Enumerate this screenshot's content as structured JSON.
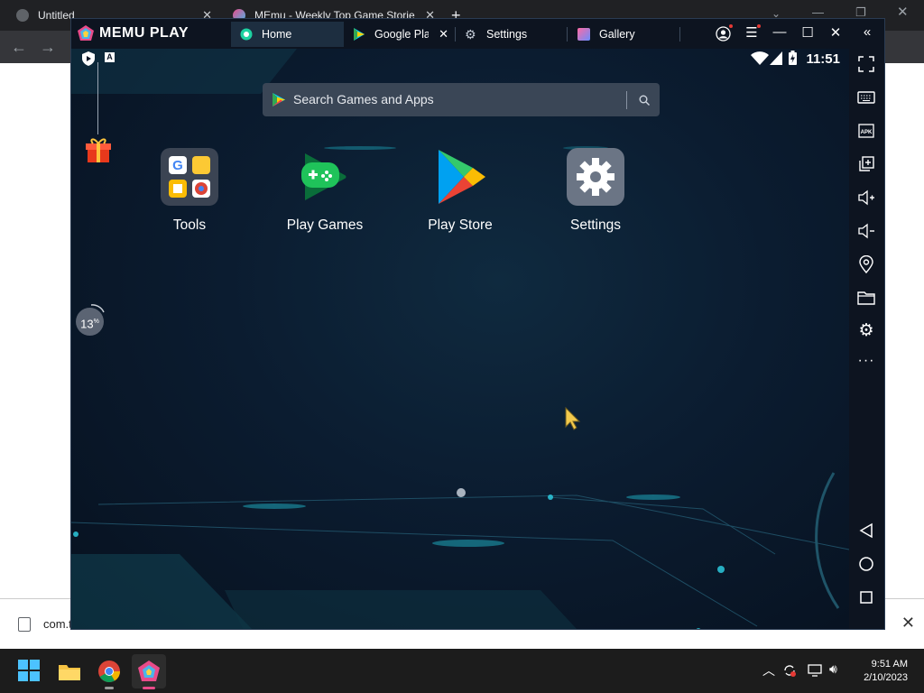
{
  "browser": {
    "tabs": [
      {
        "title": "Untitled"
      },
      {
        "title": "MEmu - Weekly Top Game Storie"
      }
    ],
    "new_tab": "+",
    "close": "✕"
  },
  "download": {
    "filename": "com.t"
  },
  "taskbar": {
    "time": "9:51 AM",
    "date": "2/10/2023"
  },
  "memu": {
    "logo": "MEMU PLAY",
    "tabs": [
      {
        "label": "Home",
        "icon": "home-icon"
      },
      {
        "label": "Google Play",
        "icon": "play-icon"
      },
      {
        "label": "Settings",
        "icon": "gear-icon"
      },
      {
        "label": "Gallery",
        "icon": "gallery-icon"
      }
    ],
    "controls": {
      "minimize": "—",
      "maximize": "☐",
      "close": "✕",
      "collapse": "«"
    }
  },
  "android": {
    "status_time": "11:51",
    "search_placeholder": "Search Games and Apps",
    "apps": [
      {
        "label": "Tools"
      },
      {
        "label": "Play Games"
      },
      {
        "label": "Play Store"
      },
      {
        "label": "Settings"
      }
    ],
    "progress": "13",
    "progress_unit": "%"
  },
  "sidebar": [
    "fullscreen-icon",
    "keyboard-icon",
    "apk-icon",
    "multi-window-icon",
    "volume-up-icon",
    "volume-down-icon",
    "location-icon",
    "folder-icon",
    "settings-icon",
    "more-icon",
    "back-icon",
    "home-nav-icon",
    "recents-icon"
  ]
}
